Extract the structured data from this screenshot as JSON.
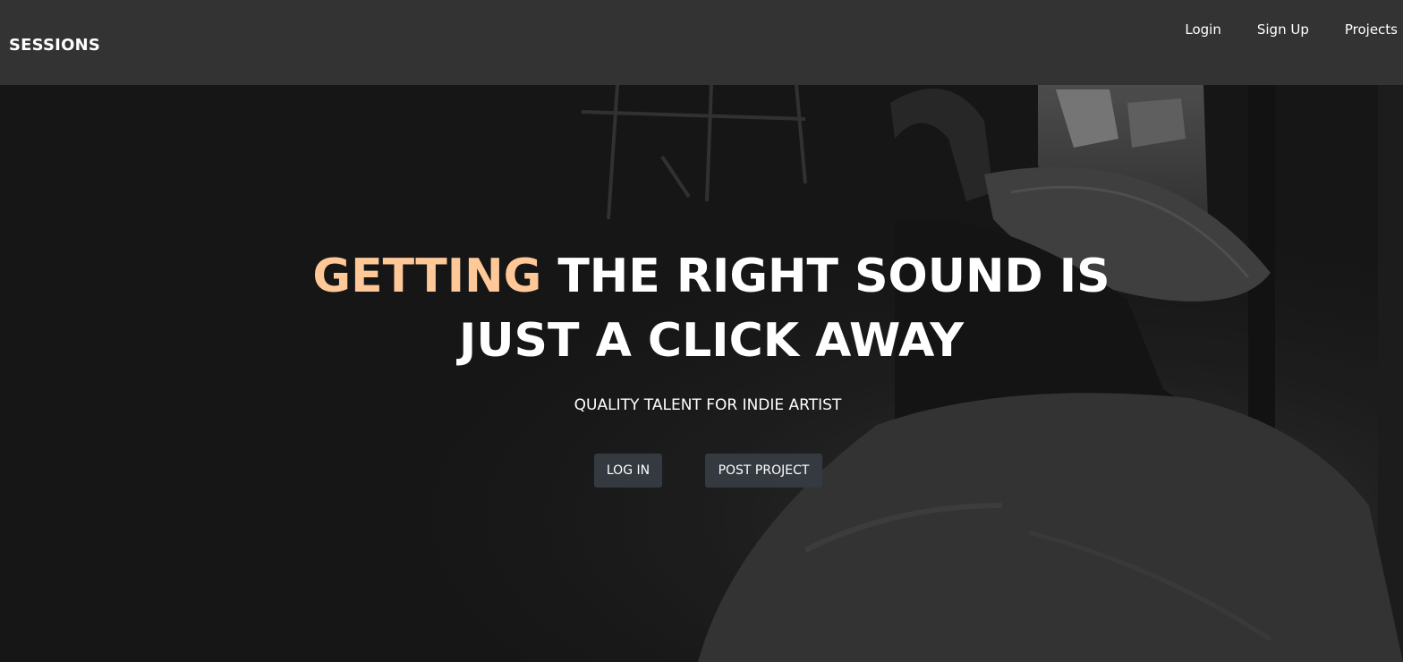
{
  "navbar": {
    "brand": "SESSIONS",
    "links": [
      {
        "label": "Login"
      },
      {
        "label": "Sign Up"
      },
      {
        "label": "Projects"
      }
    ]
  },
  "hero": {
    "headline_accent": "GETTING",
    "headline_rest": "THE RIGHT SOUND IS JUST A CLICK AWAY",
    "subtitle": "QUALITY TALENT FOR INDIE ARTIST",
    "buttons": {
      "login": "LOG IN",
      "post_project": "POST PROJECT"
    },
    "accent_color": "#ffc898",
    "button_color": "#343a40",
    "navbar_color": "#333333"
  }
}
